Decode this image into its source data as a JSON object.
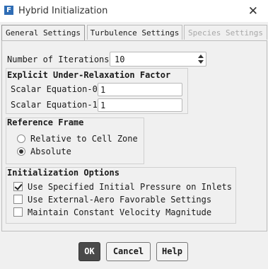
{
  "window": {
    "title": "Hybrid Initialization",
    "app_icon_glyph": "F"
  },
  "tabs": [
    {
      "label": "General Settings",
      "state": "active"
    },
    {
      "label": "Turbulence Settings",
      "state": "normal"
    },
    {
      "label": "Species Settings",
      "state": "disabled"
    }
  ],
  "iterations": {
    "label": "Number of Iterations",
    "value": "10"
  },
  "relaxation": {
    "title": "Explicit Under-Relaxation Factor",
    "fields": [
      {
        "label": "Scalar Equation-0",
        "value": "1"
      },
      {
        "label": "Scalar Equation-1",
        "value": "1"
      }
    ]
  },
  "reference_frame": {
    "title": "Reference Frame",
    "options": [
      {
        "label": "Relative to Cell Zone",
        "selected": false
      },
      {
        "label": "Absolute",
        "selected": true
      }
    ]
  },
  "init_options": {
    "title": "Initialization Options",
    "items": [
      {
        "label": "Use Specified Initial Pressure on Inlets",
        "checked": true
      },
      {
        "label": "Use External-Aero Favorable Settings",
        "checked": false
      },
      {
        "label": "Maintain Constant Velocity Magnitude",
        "checked": false
      }
    ]
  },
  "buttons": {
    "ok": "OK",
    "cancel": "Cancel",
    "help": "Help"
  }
}
